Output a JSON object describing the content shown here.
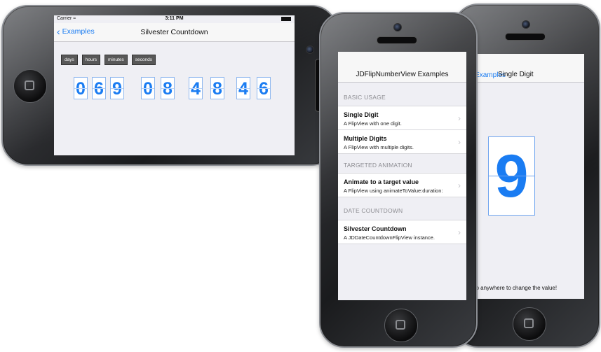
{
  "countdown_phone": {
    "status": {
      "carrier": "Carrier",
      "time": "3:11 PM"
    },
    "nav": {
      "back_label": "Examples",
      "title": "Silvester Countdown"
    },
    "unit_labels": [
      "days",
      "hours",
      "minutes",
      "seconds"
    ],
    "digits": [
      "0",
      "6",
      "9",
      "0",
      "8",
      "4",
      "8",
      "4",
      "6"
    ]
  },
  "list_phone": {
    "nav_title": "JDFlipNumberView Examples",
    "sections": [
      {
        "header": "BASIC USAGE",
        "rows": [
          {
            "title": "Single Digit",
            "subtitle": "A FlipView with one digit."
          },
          {
            "title": "Multiple Digits",
            "subtitle": "A FlipView with multiple digits."
          }
        ]
      },
      {
        "header": "TARGETED ANIMATION",
        "rows": [
          {
            "title": "Animate to a target value",
            "subtitle": "A FlipView using animateToValue:duration:"
          }
        ]
      },
      {
        "header": "DATE COUNTDOWN",
        "rows": [
          {
            "title": "Silvester Countdown",
            "subtitle": "A JDDateCountdownFlipView instance."
          }
        ]
      }
    ]
  },
  "single_digit_phone": {
    "nav": {
      "back_label": "Examples",
      "title": "Single Digit"
    },
    "digit": "9",
    "hint": "Tap anywhere to change the value!"
  },
  "colors": {
    "accent": "#1a7cf2",
    "digit_border": "#8fb8ef",
    "unit_label_bg": "#585858"
  },
  "icons": [
    "back-chevron-icon",
    "wifi-icon",
    "battery-icon",
    "chevron-right-icon",
    "home-button-icon"
  ]
}
